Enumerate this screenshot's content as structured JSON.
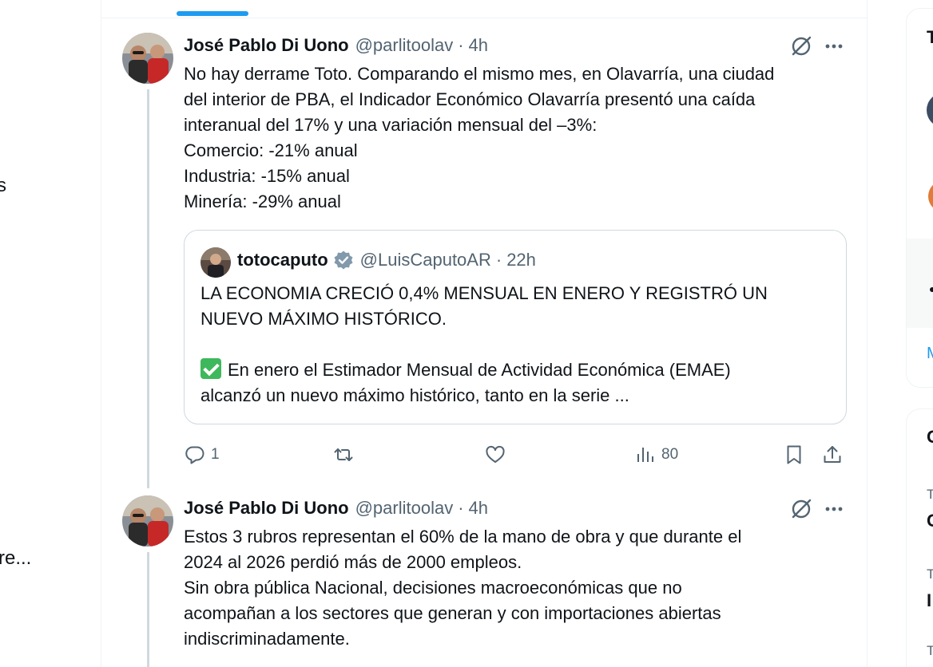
{
  "left_sidebar": {
    "fragment_1": "s",
    "fragment_2": "re..."
  },
  "tweets": [
    {
      "name": "José Pablo Di Uono",
      "handle": "@parlitoolav",
      "separator": "·",
      "time": "4h",
      "lines": [
        "No hay derrame Toto. Comparando el mismo mes, en Olavarría, una ciudad",
        "del interior de PBA, el Indicador Económico Olavarría presentó una caída",
        "interanual del 17% y una variación mensual del –3%:",
        "Comercio: -21% anual",
        "Industria: -15% anual",
        "Minería: -29% anual"
      ],
      "quote": {
        "name": "totocaputo",
        "handle": "@LuisCaputoAR",
        "separator": "·",
        "time": "22h",
        "lines": [
          "LA ECONOMIA CRECIÓ 0,4% MENSUAL EN ENERO Y REGISTRÓ UN",
          "NUEVO MÁXIMO HISTÓRICO.",
          "",
          "En enero el Estimador Mensual de Actividad Económica (EMAE)",
          "alcanzó un nuevo máximo histórico, tanto en la serie ..."
        ]
      },
      "actions": {
        "replies": "1",
        "views": "80"
      }
    },
    {
      "name": "José Pablo Di Uono",
      "handle": "@parlitoolav",
      "separator": "·",
      "time": "4h",
      "lines": [
        "Estos 3 rubros representan el 60% de la mano de obra y que durante el",
        "2024 al 2026 perdió más de 2000 empleos.",
        "Sin obra pública Nacional, decisiones macroeconómicas que no",
        "acompañan a los sectores que generan y con importaciones abiertas",
        "indiscriminadamente."
      ]
    }
  ],
  "right_sidebar": {
    "fragment_title": "T",
    "fragment_link": "M",
    "fragment_card2": "C",
    "fragment_t1": "T",
    "fragment_c1": "C",
    "fragment_t2": "T",
    "fragment_i": "I",
    "fragment_t3": "T"
  },
  "colors": {
    "accent": "#1d9bf0",
    "text": "#0f1419",
    "secondary": "#536471",
    "border": "#cfd9de"
  }
}
